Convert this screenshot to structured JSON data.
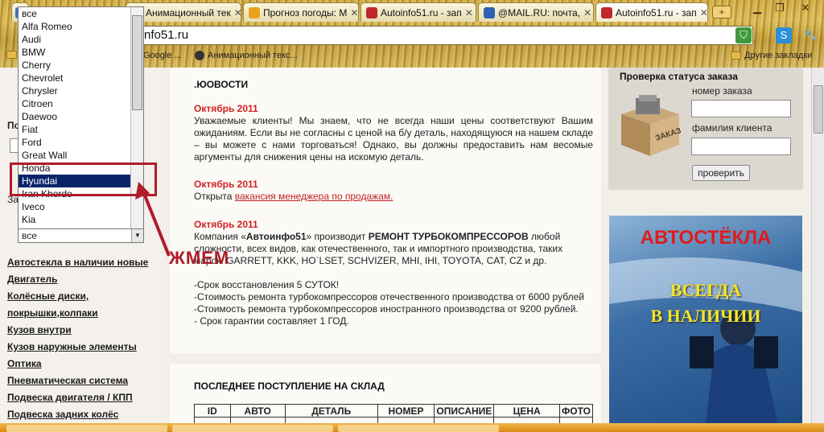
{
  "browser": {
    "tabs": [
      {
        "label": "",
        "color": "#3a6fc9"
      },
      {
        "label": "Анимационный тек",
        "color": "#3a6fc9"
      },
      {
        "label": "Прогноз погоды: М",
        "color": "#e8a21a"
      },
      {
        "label": "Autoinfo51.ru - зап",
        "color": "#c0282b"
      },
      {
        "label": "@MAIL.RU: почта,",
        "color": "#2f62b5"
      },
      {
        "label": "Autoinfo51.ru - зап",
        "color": "#c0282b"
      }
    ],
    "new_tab": "+",
    "address": "nfo51.ru",
    "bookmarks": [
      {
        "label": "Google ..."
      },
      {
        "label": "Анимационный текс..."
      },
      {
        "label": "Другие закладки"
      }
    ]
  },
  "dropdown": {
    "options": [
      "все",
      "Alfa Romeo",
      "Audi",
      "BMW",
      "Cherry",
      "Chevrolet",
      "Chrysler",
      "Citroen",
      "Daewoo",
      "Fiat",
      "Ford",
      "Great Wall",
      "Honda",
      "Hyundai",
      "Iran Khordo",
      "Iveco",
      "Kia"
    ],
    "selected_index": 13,
    "current_value": "все"
  },
  "sidebar": {
    "label_fragment": "По",
    "label_fragment2": "За",
    "links": [
      "Автостекла в наличии новые",
      "Двигатель",
      "Колёсные диски,",
      "покрышки,колпаки",
      "Кузов внутри",
      "Кузов наружные элементы",
      "Оптика",
      "Пневматическая система",
      "Подвеска двигателя / КПП",
      "Подвеска задних колёс"
    ]
  },
  "annotation": {
    "press_label": "ЖМЕМ",
    "highlight_color": "#b01c2a"
  },
  "news": {
    "heading": ".ЮОВОСТИ",
    "items": [
      {
        "date": "Октябрь 2011",
        "text": "Уважаемые клиенты! Мы знаем, что не всегда наши цены соответствуют Вашим ожиданиям. Если вы не согласны с ценой на б/у деталь, находящуюся на нашем складе – вы можете с нами торговаться! Однако, вы должны предоставить нам весомые аргументы для снижения цены на искомую деталь."
      },
      {
        "date": "Октябрь 2011",
        "text_prefix": "Открыта ",
        "link": "вакансия менеджера по продажам."
      },
      {
        "date": "Октябрь 2011",
        "line1a": "Компания «",
        "line1b": "Автоинфо51",
        "line1c": "» производит ",
        "line1d": "РЕМОНТ ТУРБОКОМПРЕССОРОВ",
        "line1e": " любой",
        "line2": "сложности, всех видов, как отечественного, так и импортного производства, таких",
        "line3": "марок: GARRETT, KKK, HO`LSET, SCHVIZER, MHI, IHI, TOYOTA, CAT, CZ и др.",
        "lines": [
          "-Срок восстановления 5 СУТОК!",
          "-Стоимость ремонта турбокомпрессоров отечественного производства от 6000 рублей",
          "-Стоимость ремонта турбокомпрессоров иностранного производства от 9200 рублей.",
          "- Срок гарантии составляет 1 ГОД."
        ]
      }
    ]
  },
  "stock": {
    "heading": "ПОСЛЕДНЕЕ ПОСТУПЛЕНИЕ НА СКЛАД",
    "columns": [
      "ID",
      "АВТО",
      "ДЕТАЛЬ",
      "НОМЕР",
      "ОПИСАНИЕ",
      "ЦЕНА",
      "ФОТО"
    ]
  },
  "order_check": {
    "title": "Проверка статуса заказа",
    "order_label": "номер заказа",
    "name_label": "фамилия клиента",
    "button": "проверить",
    "box_text": "ЗАКАЗ"
  },
  "banner": {
    "line1": "АВТОСТЁКЛА",
    "line2": "ВСЕГДА",
    "line3": "В НАЛИЧИИ"
  }
}
